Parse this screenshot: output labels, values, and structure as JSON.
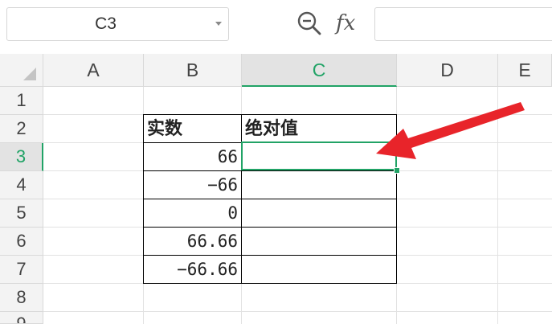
{
  "formula_bar": {
    "name_box": "C3",
    "formula_icon": "fx",
    "zoom_icon": "zoom-icon",
    "formula_value": ""
  },
  "columns": [
    "A",
    "B",
    "C",
    "D",
    "E"
  ],
  "rows": [
    "1",
    "2",
    "3",
    "4",
    "5",
    "6",
    "7",
    "8",
    "9"
  ],
  "active": {
    "column": "C",
    "row": "3"
  },
  "table": {
    "header_b": "实数",
    "header_c": "绝对值",
    "values": [
      "66",
      "−66",
      "0",
      "66.66",
      "−66.66"
    ]
  },
  "colors": {
    "accent": "#21a366",
    "arrow": "#e8242a"
  }
}
